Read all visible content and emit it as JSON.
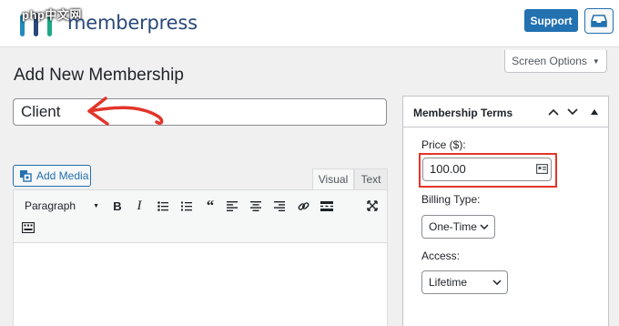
{
  "header": {
    "watermark": "php中文网",
    "brand": "memberpress",
    "support_label": "Support",
    "inbox_icon": "inbox-icon"
  },
  "screen_options": {
    "label": "Screen Options"
  },
  "page_title": "Add New Membership",
  "title_input": {
    "value": "Client"
  },
  "media": {
    "add_media_label": "Add Media"
  },
  "editor": {
    "tabs": [
      "Visual",
      "Text"
    ],
    "format_select": "Paragraph",
    "toolbar_icons": [
      "bold-icon",
      "italic-icon",
      "bullet-list-icon",
      "numbered-list-icon",
      "blockquote-icon",
      "align-left-icon",
      "align-center-icon",
      "align-right-icon",
      "link-icon",
      "read-more-icon",
      "fullscreen-icon",
      "toolbar-toggle-icon"
    ]
  },
  "membership_terms": {
    "title": "Membership Terms",
    "price_label": "Price ($):",
    "price_value": "100.00",
    "billing_label": "Billing Type:",
    "billing_value": "One-Time",
    "access_label": "Access:",
    "access_value": "Lifetime"
  },
  "colors": {
    "primary": "#2271b1",
    "highlight": "#e2352a",
    "brand_text": "#28487a"
  }
}
